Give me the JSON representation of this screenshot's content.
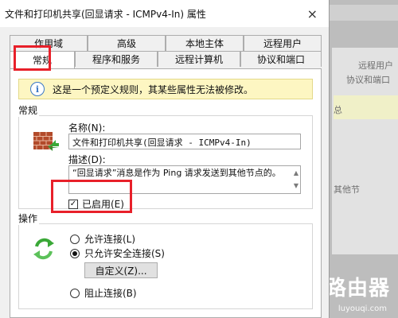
{
  "window": {
    "title": "文件和打印机共享(回显请求 - ICMPv4-In) 属性",
    "close_icon": "×"
  },
  "tabs": {
    "row1": [
      "作用域",
      "高级",
      "本地主体",
      "远程用户"
    ],
    "row2": [
      "常规",
      "程序和服务",
      "远程计算机",
      "协议和端口"
    ],
    "active": "常规"
  },
  "info_banner": {
    "icon": "i",
    "text": "这是一个预定义规则，其某些属性无法被修改。"
  },
  "general_group": {
    "label": "常规",
    "name_label": "名称(N):",
    "name_value": "文件和打印机共享(回显请求 - ICMPv4-In)",
    "desc_label": "描述(D):",
    "desc_value": "“回显请求”消息是作为 Ping 请求发送到其他节点的。",
    "enabled_label": "已启用(E)",
    "enabled_checked": true
  },
  "action_group": {
    "label": "操作",
    "allow_label": "允许连接(L)",
    "allow_secure_label": "只允许安全连接(S)",
    "customize_label": "自定义(Z)...",
    "block_label": "阻止连接(B)",
    "selected": "allow_secure"
  },
  "background_window": {
    "text1": "远程用户",
    "text2": "协议和端口",
    "text3": "总",
    "text4": "其他节"
  },
  "watermark": {
    "text": "路由器",
    "sub": "luyouqi.com"
  },
  "colors": {
    "highlight": "#e8202a",
    "info_bg": "#fdf6c2"
  }
}
